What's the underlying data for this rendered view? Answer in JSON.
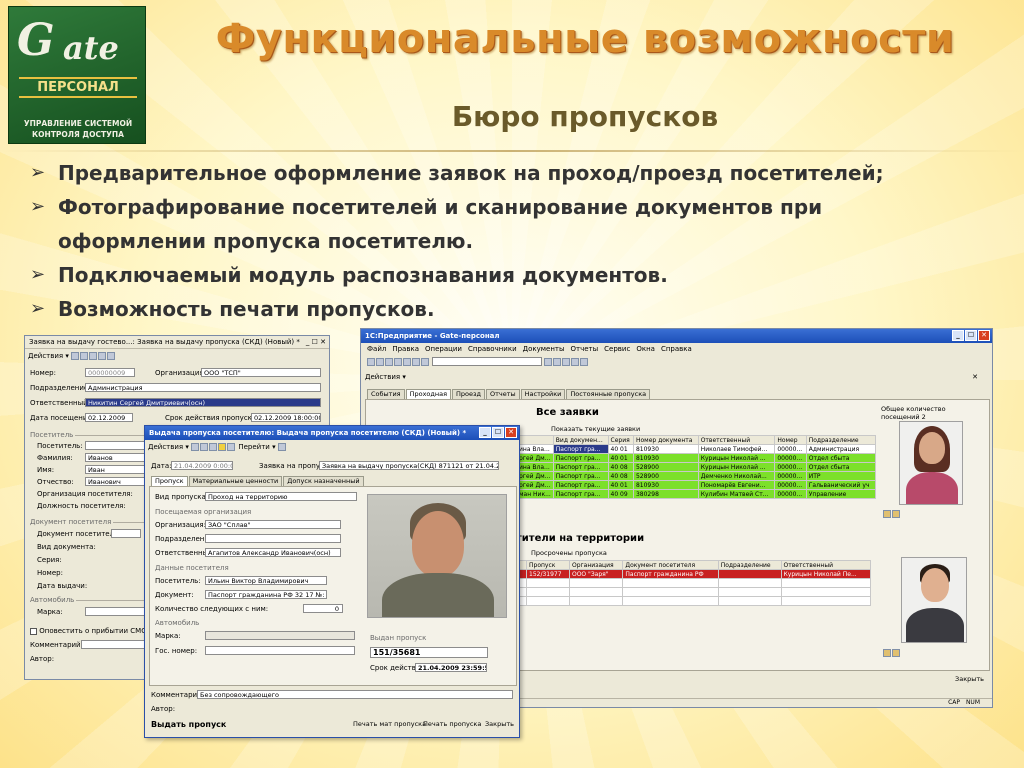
{
  "logo": {
    "gate": "G",
    "gate_rest": "ate",
    "personal": "ПЕРСОНАЛ",
    "sub1": "УПРАВЛЕНИЕ СИСТЕМОЙ",
    "sub2": "КОНТРОЛЯ ДОСТУПА"
  },
  "title": "Функциональные возможности",
  "subtitle": "Бюро пропусков",
  "bullets": [
    "Предварительное оформление заявок на проход/проезд посетителей;",
    "Фотографирование посетителей и сканирование документов при",
    "оформлении пропуска посетителю.",
    "Подключаемый модуль распознавания документов.",
    "Возможность печати пропусков."
  ],
  "left_window": {
    "title": "Заявка на выдачу гостево...: Заявка на выдачу пропуска (СКД) (Новый) *",
    "actions": "Действия",
    "number_label": "Номер:",
    "number": "000000009",
    "org_label": "Организация:",
    "org": "ООО \"ТСП\"",
    "dept_label": "Подразделение:",
    "dept": "Администрация",
    "resp_label": "Ответственный:",
    "resp": "Никитин Сергей Дмитриевич(осн)",
    "visit_label": "Дата посещения:",
    "visit": "02.12.2009",
    "valid_label": "Срок действия пропуска:",
    "valid": "02.12.2009 18:00:00",
    "visitor_group": "Посетитель",
    "visitor_label": "Посетитель:",
    "surname_label": "Фамилия:",
    "surname": "Иванов",
    "name_label": "Имя:",
    "name": "Иван",
    "patr_label": "Отчество:",
    "patr": "Иванович",
    "vorg_label": "Организация посетителя:",
    "vpos_label": "Должность посетителя:",
    "doc_group": "Документ посетителя",
    "doc_label": "Документ посетителя:",
    "doctype_label": "Вид документа:",
    "series_label": "Серия:",
    "num_label": "Номер:",
    "issued_label": "Дата выдачи:",
    "auto_group": "Автомобиль",
    "brand_label": "Марка:",
    "notify_label": "Оповестить о прибытии СМС",
    "comment_label": "Комментарий:",
    "author_label": "Автор:"
  },
  "right_window": {
    "title": "1С:Предприятие - Gate-персонал",
    "menu": [
      "Файл",
      "Правка",
      "Операции",
      "Справочники",
      "Документы",
      "Отчеты",
      "Сервис",
      "Окна",
      "Справка"
    ],
    "actions": "Действия",
    "tabs": [
      "События",
      "Проходная",
      "Проезд",
      "Отчеты",
      "Настройки",
      "Постоянные пропуска"
    ],
    "all_requests": "Все заявки",
    "show_current": "Показать текущие заявки",
    "columns": [
      "Вид докумен...",
      "Серия",
      "Номер документа",
      "Ответственный",
      "Номер",
      "Подразделение"
    ],
    "rows": [
      {
        "name": "ина Вла...",
        "doc": "Паспорт гра...",
        "series": "40 01",
        "num": "810930",
        "resp": "Николаев Тимофей...",
        "no": "00000...",
        "dept": "Администрация"
      },
      {
        "name": "ргей Дм...",
        "doc": "Паспорт гра...",
        "series": "40 01",
        "num": "810930",
        "resp": "Курицын Николай ...",
        "no": "00000...",
        "dept": "Отдел сбыта"
      },
      {
        "name": "ина Вла...",
        "doc": "Паспорт гра...",
        "series": "40 08",
        "num": "528900",
        "resp": "Курицын Николай ...",
        "no": "00000...",
        "dept": "Отдел сбыта"
      },
      {
        "name": "ргей Дм...",
        "doc": "Паспорт гра...",
        "series": "40 08",
        "num": "528900",
        "resp": "Демченко Николай...",
        "no": "00000...",
        "dept": "ИТР"
      },
      {
        "name": "ргей Дм...",
        "doc": "Паспорт гра...",
        "series": "40 01",
        "num": "810930",
        "resp": "Пономарёв Евгени...",
        "no": "00000...",
        "dept": "Гальванический уч"
      },
      {
        "name": "ман Ник...",
        "doc": "Паспорт гра...",
        "series": "40 09",
        "num": "380298",
        "resp": "Кулибин Матвей Ст...",
        "no": "00000...",
        "dept": "Управление"
      }
    ],
    "count_label": "Общее количество посещений 2",
    "on_territory": "тители на территории",
    "tabs2": [
      "Пропуск",
      "Организация",
      "Документ посетителя",
      "Подразделение",
      "Ответственный"
    ],
    "overdue": "Просрочены пропуска",
    "red_row": {
      "pass": "152/31977",
      "org": "ООО \"Заря\"",
      "doc": "Паспорт гражданина РФ",
      "dept": "",
      "resp": "Курицын Николай Пе..."
    },
    "close": "Закрыть",
    "status": [
      "CAP",
      "NUM"
    ]
  },
  "front_window": {
    "title": "Выдача пропуска посетителю: Выдача пропуска посетителю (СКД) (Новый) *",
    "actions": "Действия",
    "goto": "Перейти",
    "date_label": "Дата:",
    "date": "21.04.2009 0:00:00",
    "req_label": "Заявка на пропуск:",
    "req": "Заявка на выдачу пропуска(СКД) 871121 от 21.04.2009",
    "tabs": [
      "Пропуск",
      "Материальные ценности",
      "Допуск назначенный"
    ],
    "passtype_label": "Вид пропуска:",
    "passtype": "Проход на территорию",
    "org_group": "Посещаемая организация",
    "org_label": "Организация:",
    "org": "ЗАО \"Сплав\"",
    "dept_label": "Подразделение:",
    "resp_label": "Ответственный:",
    "resp": "Агапитов Александр Иванович(осн)",
    "visitor_group": "Данные посетителя",
    "visitor_label": "Посетитель:",
    "visitor": "Ильин Виктор Владимирович",
    "doc_label": "Документ:",
    "doc": "Паспорт гражданина РФ 32 17 №: 89",
    "count_label": "Количество следующих с ним:",
    "count": "0",
    "auto_group": "Автомобиль",
    "brand_label": "Марка:",
    "plate_label": "Гос. номер:",
    "issued_group": "Выдан пропуск",
    "pass_no": "151/35681",
    "valid_label": "Срок действия:",
    "valid": "21.04.2009 23:59:59",
    "comment_label": "Комментарий:",
    "comment": "Без сопровождающего",
    "author_label": "Автор:",
    "issue_btn": "Выдать пропуск",
    "print_mat": "Печать мат пропуска",
    "print": "Печать пропуска",
    "close": "Закрыть"
  },
  "colors": {
    "title": "#d98a2a",
    "green_row": "#7ce02a",
    "red_row": "#c82020",
    "titlebar": "#1c4fb8"
  }
}
